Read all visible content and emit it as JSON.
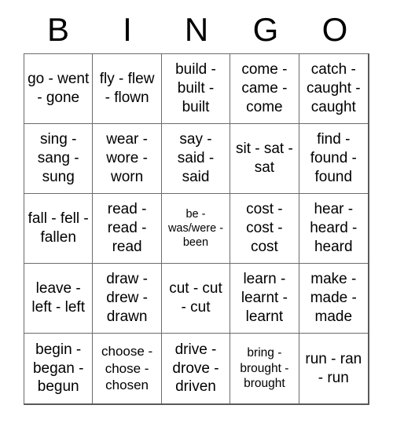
{
  "card": {
    "title": "BINGO",
    "headers": [
      "B",
      "I",
      "N",
      "G",
      "O"
    ],
    "grid_columns": 5,
    "grid_rows": 5,
    "colors": {
      "background": "#ffffff",
      "text": "#000000",
      "grid_line": "#6b6b6b",
      "outer_border": "#595959"
    },
    "cells": [
      {
        "text": "go - went - gone",
        "size": "lg"
      },
      {
        "text": "fly - flew - flown",
        "size": "lg"
      },
      {
        "text": "build - built - built",
        "size": "lg"
      },
      {
        "text": "come - came - come",
        "size": "lg"
      },
      {
        "text": "catch - caught - caught",
        "size": "lg"
      },
      {
        "text": "sing - sang - sung",
        "size": "lg"
      },
      {
        "text": "wear - wore - worn",
        "size": "lg"
      },
      {
        "text": "say - said - said",
        "size": "lg"
      },
      {
        "text": "sit - sat - sat",
        "size": "lg"
      },
      {
        "text": "find - found - found",
        "size": "lg"
      },
      {
        "text": "fall - fell - fallen",
        "size": "lg"
      },
      {
        "text": "read - read - read",
        "size": "lg"
      },
      {
        "text": "be - was/were - been",
        "size": "xs"
      },
      {
        "text": "cost - cost - cost",
        "size": "lg"
      },
      {
        "text": "hear - heard - heard",
        "size": "lg"
      },
      {
        "text": "leave - left - left",
        "size": "lg"
      },
      {
        "text": "draw - drew - drawn",
        "size": "lg"
      },
      {
        "text": "cut - cut - cut",
        "size": "lg"
      },
      {
        "text": "learn - learnt - learnt",
        "size": "lg"
      },
      {
        "text": "make - made - made",
        "size": "lg"
      },
      {
        "text": "begin - began - begun",
        "size": "lg"
      },
      {
        "text": "choose - chose - chosen",
        "size": "md"
      },
      {
        "text": "drive - drove - driven",
        "size": "lg"
      },
      {
        "text": "bring - brought - brought",
        "size": "sm"
      },
      {
        "text": "run - ran - run",
        "size": "lg"
      }
    ]
  }
}
